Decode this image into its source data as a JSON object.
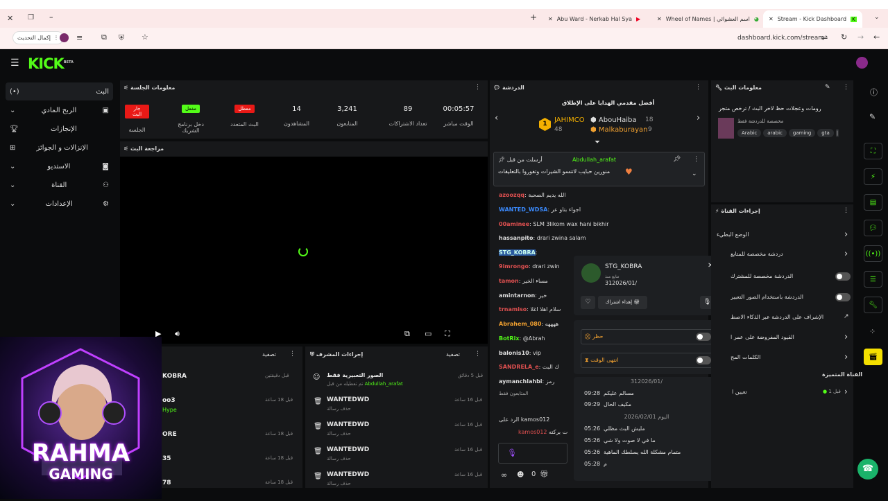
{
  "browser": {
    "tabs": [
      {
        "title": "Abu Ward - Nerkab Hal Sya"
      },
      {
        "title": "Wheel of Names | اسم العشوائي"
      },
      {
        "title": "Stream - Kick Dashboard"
      }
    ],
    "update_label": "إكمال التحديث",
    "url": "dashboard.kick.com/stream"
  },
  "brand": {
    "name": "KICK",
    "beta": "BETA"
  },
  "sidebar": {
    "items": [
      {
        "label": "البث",
        "icon": "broadcast-icon"
      },
      {
        "label": "الربح المادي",
        "icon": "money-icon"
      },
      {
        "label": "الإنجازات",
        "icon": "trophy-icon"
      },
      {
        "label": "الإنزالات و الجوائز",
        "icon": "drops-icon"
      },
      {
        "label": "الاستديو",
        "icon": "studio-icon"
      },
      {
        "label": "القناة",
        "icon": "channel-icon"
      },
      {
        "label": "الإعدادات",
        "icon": "gear-icon"
      }
    ]
  },
  "session": {
    "title": "معلومات الجلسة",
    "stats": [
      {
        "badge": "جار البث",
        "label": "الجلسة",
        "badge_color": "#e91916"
      },
      {
        "badge": "مفعل",
        "label": "دخل برنامج الشريك",
        "badge_color": "#53fc18"
      },
      {
        "badge": "معطل",
        "label": "البث المتعدد",
        "badge_color": "#e91916"
      },
      {
        "value": "14",
        "label": "المشاهدون"
      },
      {
        "value": "3,241",
        "label": "المتابعون"
      },
      {
        "value": "89",
        "label": "تعداد الاشتراكات"
      },
      {
        "value": "00:05:57",
        "label": "الوقت مباشر"
      }
    ]
  },
  "preview": {
    "title": "مراجعة البث"
  },
  "filter_label": "تصفية",
  "feed_left": [
    {
      "name": "KOBRA",
      "time": "قبل دقيقتين"
    },
    {
      "name": "oo3",
      "time": "قبل 18 ساعة",
      "sub": "Hype"
    },
    {
      "name": "ORE",
      "time": "قبل 18 ساعة"
    },
    {
      "name": "35",
      "time": "قبل 18 ساعة"
    },
    {
      "name": "78",
      "time": "قبل 18 ساعة"
    }
  ],
  "mod": {
    "title": "إجراءات المشرف",
    "items": [
      {
        "title": "الصور التعبيرية فقط",
        "sub": "تم تعطيله من قبل",
        "by": "Abdullah_arafat",
        "time": "قبل 5 دقائق"
      },
      {
        "title": "WANTEDWD",
        "sub": "حذف رسالة",
        "time": "قبل 16 ساعة"
      },
      {
        "title": "WANTEDWD",
        "sub": "حذف رسالة",
        "time": "قبل 16 ساعة"
      },
      {
        "title": "WANTEDWD",
        "sub": "حذف رسالة",
        "time": "قبل 16 ساعة"
      },
      {
        "title": "WANTEDWD",
        "sub": "حذف رسالة",
        "time": "قبل 16 ساعة"
      }
    ]
  },
  "chat": {
    "title": "الدردشة",
    "top_gifters_title": "أفضل مقدمي الهدايا على الإطلاق",
    "gifters": [
      {
        "rank": "1",
        "name": "JAHIMCO",
        "count": "48"
      },
      {
        "name": "AbouHaiba",
        "count": "18"
      },
      {
        "name": "Malkaburayan",
        "count": "9"
      }
    ],
    "pinned": {
      "by": "أرسلت من قبل",
      "user": "Abdullah_arafat",
      "text": "منورين حبايب لاتنسو الشيرات وتفوروا بالتعليقات"
    },
    "lines": [
      {
        "user": "azoozqq",
        "color": "#e05050",
        "text": "الله يديم الصحبة"
      },
      {
        "user": "WANTED_WDSA",
        "color": "#3b8bff",
        "text": "اجواء بتاو عر"
      },
      {
        "user": "00aminee",
        "color": "#e05050",
        "text": "SLM 3likom wax hani bikhir"
      },
      {
        "user": "hassanpito",
        "color": "#ddd",
        "text": "drari zwina salam"
      },
      {
        "user": "STG_KOBRA",
        "color": "#cfe",
        "text": ""
      },
      {
        "user": "9imrongo",
        "color": "#e05050",
        "text": "drari zwin"
      },
      {
        "user": "tamon",
        "color": "#e05050",
        "text": "مساء الخير"
      },
      {
        "user": "amintarnon",
        "color": "#ddd",
        "text": "خير"
      },
      {
        "user": "trnamiso",
        "color": "#e05050",
        "text": "سلام اهلا اغلا"
      },
      {
        "user": "Abrahem_080",
        "color": "#f0a030",
        "text": "ههههه"
      },
      {
        "user": "BotRix",
        "color": "#53fc18",
        "text": "@Abrah"
      },
      {
        "user": "balonis10",
        "color": "#ddd",
        "text": "vip"
      },
      {
        "user": "SANDRELA_e",
        "color": "#e05050",
        "text": "ك البث"
      },
      {
        "user": "aymanchlahbi",
        "color": "#ddd",
        "text": "رمز"
      }
    ],
    "reply_to": "الرد على kamos012",
    "reply_user": "kamos012",
    "reply_text": "ت بركته",
    "subs_only": "المتابعون فقط",
    "footer_count": "0"
  },
  "user_card": {
    "username": "STG_KOBRA",
    "follow_label": "تتابع منذ",
    "follow_date": "312026/01/",
    "gift_label": "إهداء اشتراك",
    "ban_label": "حظر",
    "timeout_label": "انتهى الوقت",
    "history": [
      {
        "date": "312026/01/"
      },
      {
        "text": "مسالم عليكم",
        "time": "09:28"
      },
      {
        "text": "مكيف الحال",
        "time": "09:29"
      },
      {
        "date": "اليوم 2026/02/01"
      },
      {
        "text": "مليش البث مظلي",
        "time": "05:26"
      },
      {
        "text": "ما في لا صوت ولا شي",
        "time": "05:26"
      },
      {
        "text": "متمام مشكلة الله يسلطك الماهية",
        "time": "05:26"
      },
      {
        "text": "م",
        "time": "05:28"
      }
    ]
  },
  "stream_info": {
    "title": "معلومات البث",
    "stream_title": "رومات وعجلات حظ لاخر البث / ترخص متجر",
    "category": "مخصصة للدردشة فقط",
    "tags": [
      "Arabic",
      "arabic",
      "gaming",
      "gta"
    ]
  },
  "channel_actions": {
    "title": "إجراءات القناة",
    "items": [
      {
        "label": "الوضع البطيء",
        "type": "arrow"
      },
      {
        "label": "دردشة مخصصة للمتابع",
        "type": "arrow"
      },
      {
        "label": "الدردشة مخصصة للمشترك",
        "type": "toggle"
      },
      {
        "label": "الدردشة باستخدام الصور التعبير",
        "type": "toggle"
      },
      {
        "label": "الإشراف على الدردشة عبر الذكاء الاصط",
        "type": "link"
      },
      {
        "label": "القيود المفروضة على عمر ا",
        "type": "arrow"
      },
      {
        "label": "الكلمات المح",
        "type": "arrow"
      }
    ],
    "promoted_title": "القناة المتميزة",
    "promoted_label": "تعيين ا",
    "promoted_value": "قبل 1"
  },
  "overlay": {
    "line1": "RAHMA",
    "line2": "GAMING"
  },
  "colors": {
    "accent": "#53fc18",
    "danger": "#e91916",
    "panel": "#17181a",
    "bg": "#0b0c0d"
  }
}
